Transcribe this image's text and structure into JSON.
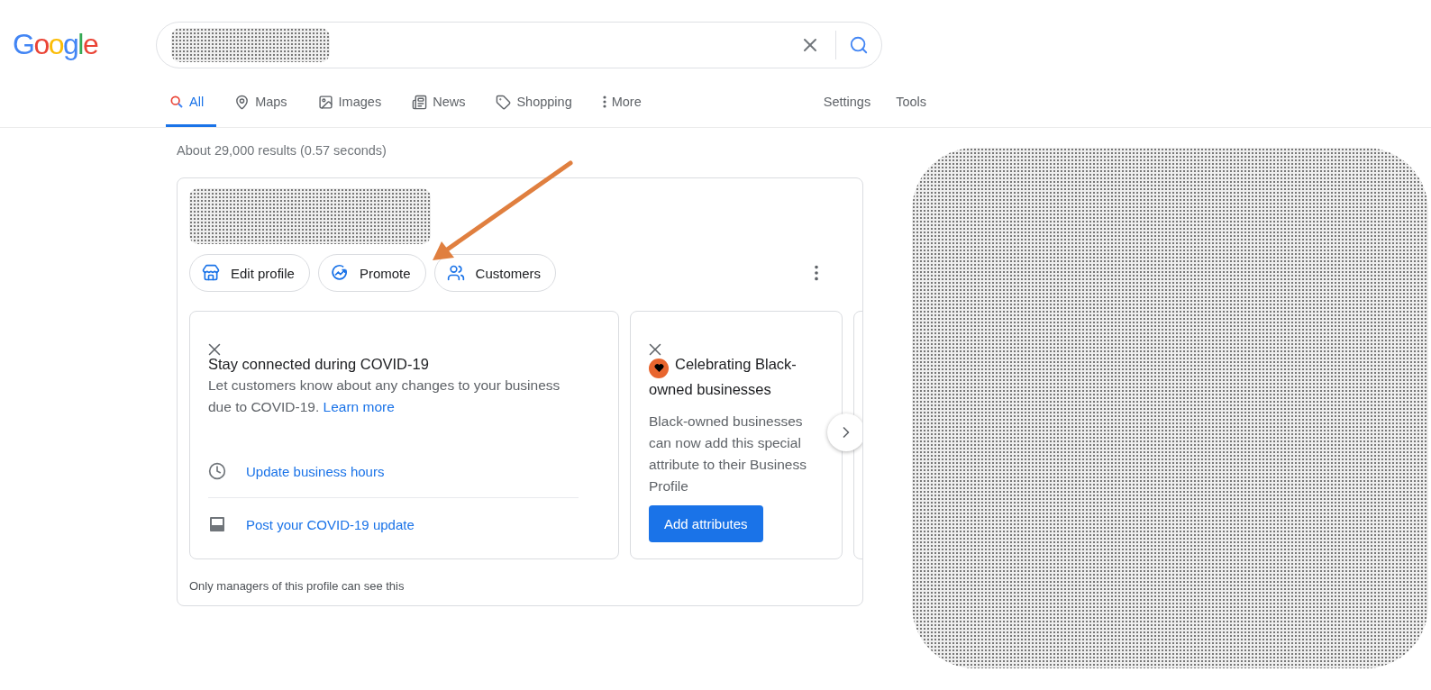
{
  "logo": "Google",
  "search": {
    "redacted": true
  },
  "tabs": [
    {
      "label": "All",
      "selected": true
    },
    {
      "label": "Maps",
      "selected": false
    },
    {
      "label": "Images",
      "selected": false
    },
    {
      "label": "News",
      "selected": false
    },
    {
      "label": "Shopping",
      "selected": false
    },
    {
      "label": "More",
      "selected": false
    }
  ],
  "tools": [
    "Settings",
    "Tools"
  ],
  "result_stats": "About 29,000 results (0.57 seconds)",
  "profile_card": {
    "actions": [
      "Edit profile",
      "Promote",
      "Customers"
    ],
    "covid_card": {
      "title": "Stay connected during COVID-19",
      "text": "Let customers know about any changes to your business due to COVID-19.",
      "link": "Learn more",
      "items": [
        "Update business hours",
        "Post your COVID-19 update"
      ]
    },
    "attribute_card": {
      "title": "Celebrating Black-owned businesses",
      "text": "Black-owned businesses can now add this special attribute to their Business Profile",
      "button": "Add attributes"
    },
    "footnote": "Only managers of this profile can see this"
  }
}
